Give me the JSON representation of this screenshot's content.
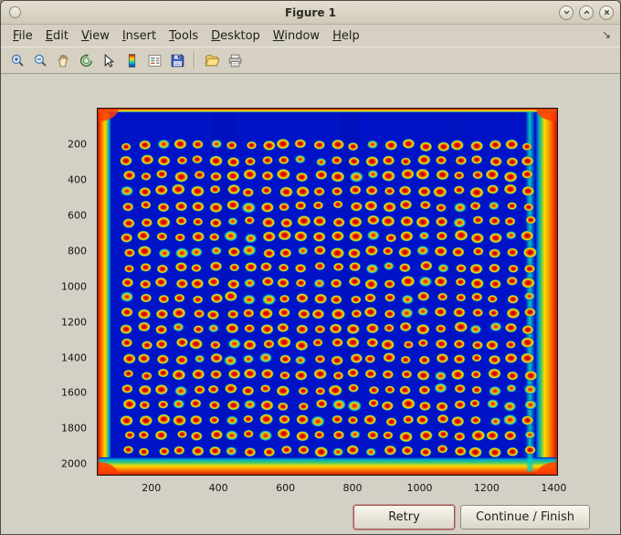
{
  "window": {
    "title": "Figure 1",
    "controls": {
      "minimize": "minimize",
      "maximize": "maximize",
      "close": "close"
    }
  },
  "menubar": {
    "items": [
      {
        "label": "File",
        "accel": 0
      },
      {
        "label": "Edit",
        "accel": 0
      },
      {
        "label": "View",
        "accel": 0
      },
      {
        "label": "Insert",
        "accel": 0
      },
      {
        "label": "Tools",
        "accel": 0
      },
      {
        "label": "Desktop",
        "accel": 0
      },
      {
        "label": "Window",
        "accel": 0
      },
      {
        "label": "Help",
        "accel": 0
      }
    ],
    "dock_glyph": "↘"
  },
  "toolbar": {
    "buttons": [
      "zoom-in",
      "zoom-out",
      "pan",
      "rotate-3d",
      "data-cursor",
      "colorbar",
      "legend",
      "save",
      "open",
      "print"
    ]
  },
  "chart_data": {
    "type": "heatmap",
    "description": "Pseudocolor (jet colormap) image of a scanned microplate: deep blue field with a regular grid of red/orange well spots, hot red-orange edges, thin yellow-green transition bands and a cyan strip near the right edge",
    "x_ticks": [
      200,
      400,
      600,
      800,
      1000,
      1200,
      1400
    ],
    "y_ticks": [
      200,
      400,
      600,
      800,
      1000,
      1200,
      1400,
      1600,
      1800,
      2000
    ],
    "x_range": [
      40,
      1410
    ],
    "y_range": [
      0,
      2060
    ],
    "grid": {
      "rows": 21,
      "cols": 24,
      "x_start": 130,
      "x_step": 52,
      "y_start": 205,
      "y_step": 86,
      "dot_rx": 18,
      "dot_ry": 27
    },
    "colors": {
      "background": "#0013c6",
      "well_core": "#c00000",
      "well_ring": "#ff8c00",
      "well_halo": "#ffe000",
      "edge_hot": "#e83000",
      "edge_warm": "#ff8c00",
      "edge_green": "#48c85a",
      "strip_cyan": "#00d0c0"
    },
    "green_fraction": 0.16,
    "seed": 7
  },
  "buttons": {
    "retry_label": "Retry",
    "continue_label": "Continue / Finish"
  }
}
